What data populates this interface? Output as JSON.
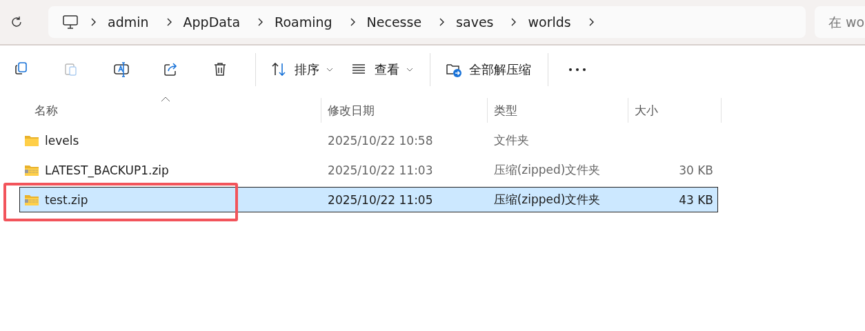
{
  "address_bar": {
    "crumbs": [
      "admin",
      "AppData",
      "Roaming",
      "Necesse",
      "saves",
      "worlds"
    ]
  },
  "search": {
    "placeholder": "在 wo"
  },
  "toolbar": [
    {
      "kind": "copy",
      "disabled": false
    },
    {
      "kind": "paste",
      "disabled": true
    },
    {
      "kind": "rename",
      "disabled": false
    },
    {
      "kind": "share",
      "disabled": false
    },
    {
      "kind": "delete",
      "disabled": false
    },
    {
      "kind": "sort",
      "label": "排序",
      "disabled": false
    },
    {
      "kind": "view",
      "label": "查看",
      "disabled": false
    },
    {
      "kind": "extract",
      "label": "全部解压缩",
      "disabled": false
    },
    {
      "kind": "more",
      "disabled": false
    }
  ],
  "table": {
    "columns": [
      {
        "label": "名称",
        "sorted": true
      },
      {
        "label": "修改日期",
        "sorted": false
      },
      {
        "label": "类型",
        "sorted": false
      },
      {
        "label": "大小",
        "sorted": false
      }
    ],
    "rows": [
      {
        "kind": "folder",
        "name": "levels",
        "modified": "2025/10/22 10:58",
        "type": "文件夹",
        "selected": false,
        "highlighted": false
      },
      {
        "kind": "zip",
        "name": "LATEST_BACKUP1.zip",
        "modified": "2025/10/22 11:03",
        "type": "压缩(zipped)文件夹",
        "size": "30 KB",
        "selected": false,
        "highlighted": false
      },
      {
        "kind": "zip",
        "name": "test.zip",
        "modified": "2025/10/22 11:05",
        "type": "压缩(zipped)文件夹",
        "size": "43 KB",
        "selected": true,
        "highlighted": true
      }
    ]
  }
}
